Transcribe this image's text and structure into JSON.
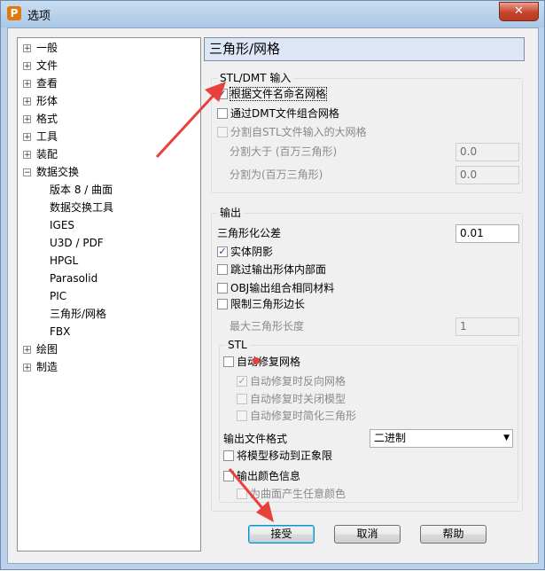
{
  "window": {
    "title": "选项",
    "app_icon": "P",
    "close_glyph": "✕"
  },
  "tree": {
    "items": [
      {
        "label": "一般",
        "level": 0,
        "expander": "+"
      },
      {
        "label": "文件",
        "level": 0,
        "expander": "+"
      },
      {
        "label": "查看",
        "level": 0,
        "expander": "+"
      },
      {
        "label": "形体",
        "level": 0,
        "expander": "+"
      },
      {
        "label": "格式",
        "level": 0,
        "expander": "+"
      },
      {
        "label": "工具",
        "level": 0,
        "expander": "+"
      },
      {
        "label": "装配",
        "level": 0,
        "expander": "+"
      },
      {
        "label": "数据交换",
        "level": 0,
        "expander": "−"
      },
      {
        "label": "版本 8 / 曲面",
        "level": 1
      },
      {
        "label": "数据交换工具",
        "level": 1
      },
      {
        "label": "IGES",
        "level": 1
      },
      {
        "label": "U3D / PDF",
        "level": 1
      },
      {
        "label": "HPGL",
        "level": 1
      },
      {
        "label": "Parasolid",
        "level": 1
      },
      {
        "label": "PIC",
        "level": 1
      },
      {
        "label": "三角形/网格",
        "level": 1,
        "selected": true
      },
      {
        "label": "FBX",
        "level": 1
      },
      {
        "label": "绘图",
        "level": 0,
        "expander": "+"
      },
      {
        "label": "制造",
        "level": 0,
        "expander": "+"
      }
    ]
  },
  "panel": {
    "title": "三角形/网格",
    "stl_input": {
      "group_title": "STL/DMT 输入",
      "name_mesh_by_file": {
        "label": "根据文件名命名网格",
        "checked": true
      },
      "combine_via_dmt": {
        "label": "通过DMT文件组合网格",
        "checked": false
      },
      "split_large_mesh": {
        "label": "分割自STL文件输入的大网格",
        "checked": false
      },
      "split_greater_label": "分割大于 (百万三角形)",
      "split_greater_value": "0.0",
      "split_into_label": "分割为(百万三角形)",
      "split_into_value": "0.0"
    },
    "output": {
      "group_title": "输出",
      "tolerance_label": "三角形化公差",
      "tolerance_value": "0.01",
      "solid_shading": {
        "label": "实体阴影",
        "checked": true
      },
      "skip_internal_faces": {
        "label": "跳过输出形体内部面",
        "checked": false
      },
      "obj_combine_material": {
        "label": "OBJ输出组合相同材料",
        "checked": false
      },
      "limit_edge": {
        "label": "限制三角形边长",
        "checked": false
      },
      "max_length_label": "最大三角形长度",
      "max_length_value": "1",
      "stl": {
        "group_title": "STL",
        "auto_repair": {
          "label": "自动修复网格",
          "checked": false
        },
        "repair_reversed": {
          "label": "自动修复时反向网格",
          "checked": true
        },
        "repair_close": {
          "label": "自动修复时关闭模型",
          "checked": false
        },
        "repair_simplify": {
          "label": "自动修复时简化三角形",
          "checked": false
        },
        "format_label": "输出文件格式",
        "format_value": "二进制",
        "move_to_positive": {
          "label": "将模型移动到正象限",
          "checked": false
        },
        "output_color": {
          "label": "输出颜色信息",
          "checked": false
        },
        "any_color_surfaces": {
          "label": "为曲面产生任意颜色",
          "checked": false
        }
      }
    }
  },
  "buttons": {
    "accept": "接受",
    "cancel": "取消",
    "help": "帮助"
  },
  "colors": {
    "annotation_arrow": "#e8413c"
  },
  "glyphs": {
    "check": "✓",
    "dropdown": "▼"
  }
}
